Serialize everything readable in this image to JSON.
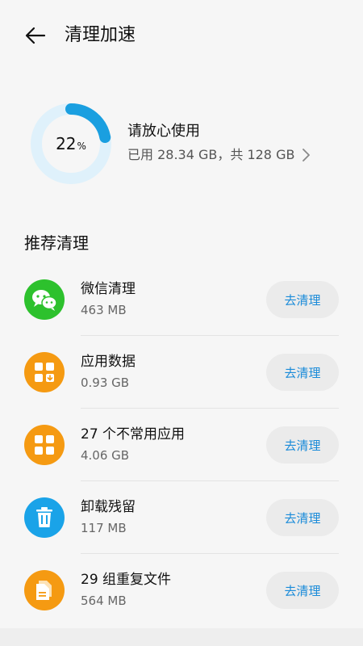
{
  "header": {
    "title": "清理加速"
  },
  "storage": {
    "percent": 22,
    "percent_value": "22",
    "percent_unit": "%",
    "status": "请放心使用",
    "detail": "已用 28.34 GB，共 128 GB",
    "ring_color": "#1a9fe0",
    "ring_track_color": "#dff1fb"
  },
  "recommend": {
    "title": "推荐清理",
    "button_label": "去清理",
    "items": [
      {
        "name": "微信清理",
        "size": "463 MB",
        "icon": "wechat-icon",
        "color": "#2dc12d"
      },
      {
        "name": "应用数据",
        "size": "0.93 GB",
        "icon": "app-data-icon",
        "color": "#f59a12"
      },
      {
        "name": "27 个不常用应用",
        "size": "4.06 GB",
        "icon": "apps-grid-icon",
        "color": "#f59a12"
      },
      {
        "name": "卸载残留",
        "size": "117 MB",
        "icon": "trash-icon",
        "color": "#1aa3e8"
      },
      {
        "name": "29 组重复文件",
        "size": "564 MB",
        "icon": "duplicate-files-icon",
        "color": "#f59a12"
      }
    ]
  }
}
